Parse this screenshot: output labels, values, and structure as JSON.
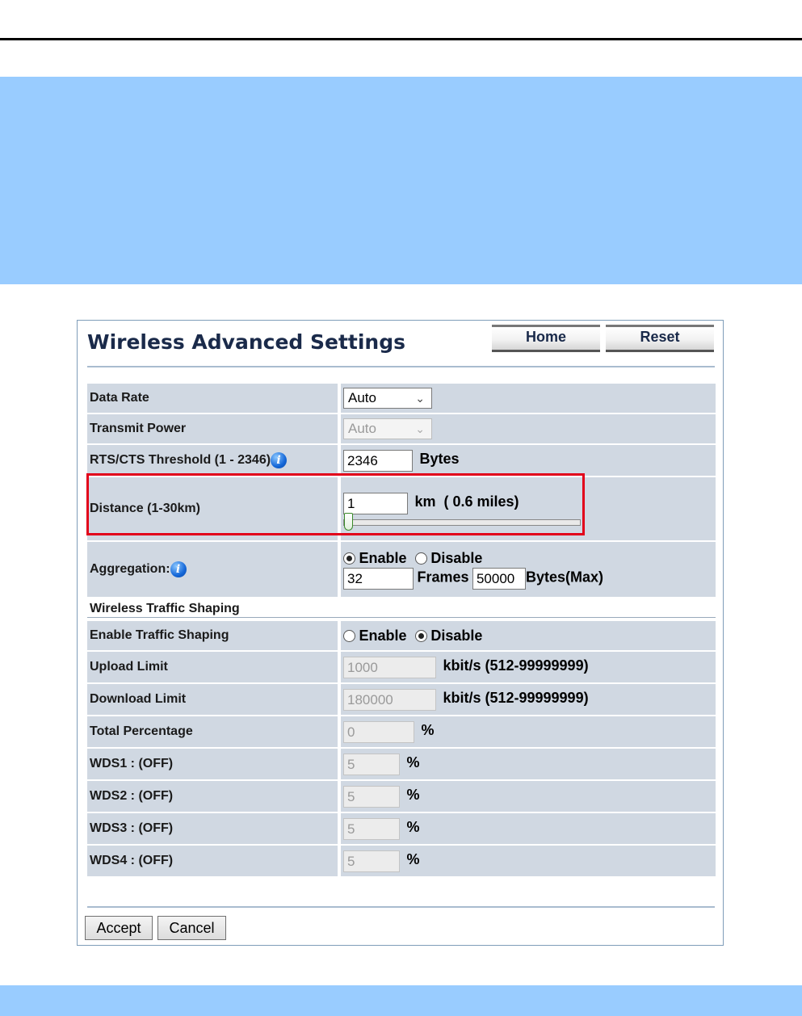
{
  "page": {
    "title": "Wireless Advanced Settings",
    "home_label": "Home",
    "reset_label": "Reset"
  },
  "rows": {
    "data_rate": {
      "label": "Data Rate",
      "value": "Auto"
    },
    "transmit_power": {
      "label": "Transmit Power",
      "value": "Auto"
    },
    "rts": {
      "label": "RTS/CTS Threshold (1 - 2346)",
      "value": "2346",
      "unit": "Bytes"
    },
    "distance": {
      "label": "Distance (1-30km)",
      "value": "1",
      "unit": "km  ( 0.6 miles)",
      "slider_min": 1,
      "slider_max": 30,
      "slider_value": 1
    },
    "aggregation": {
      "label": "Aggregation:",
      "enable_label": "Enable",
      "disable_label": "Disable",
      "selected": "Enable",
      "frames_value": "32",
      "frames_label": "Frames",
      "bytes_value": "50000",
      "bytes_label": "Bytes(Max)"
    }
  },
  "shaping": {
    "section_title": "Wireless Traffic Shaping",
    "enable": {
      "label": "Enable Traffic Shaping",
      "enable_label": "Enable",
      "disable_label": "Disable",
      "selected": "Disable"
    },
    "upload": {
      "label": "Upload Limit",
      "value": "1000",
      "unit": "kbit/s (512-99999999)"
    },
    "download": {
      "label": "Download Limit",
      "value": "180000",
      "unit": "kbit/s (512-99999999)"
    },
    "total": {
      "label": "Total Percentage",
      "value": "0",
      "unit": "%"
    },
    "wds": [
      {
        "label": "WDS1 : (OFF)",
        "value": "5",
        "unit": "%"
      },
      {
        "label": "WDS2 : (OFF)",
        "value": "5",
        "unit": "%"
      },
      {
        "label": "WDS3 : (OFF)",
        "value": "5",
        "unit": "%"
      },
      {
        "label": "WDS4 : (OFF)",
        "value": "5",
        "unit": "%"
      }
    ]
  },
  "actions": {
    "accept_label": "Accept",
    "cancel_label": "Cancel"
  },
  "colors": {
    "band": "#99ccff",
    "row_bg": "#d0d8e2",
    "highlight": "#e2001a"
  },
  "icons": {
    "info": "info-icon",
    "dropdown": "chevron-down-icon"
  }
}
